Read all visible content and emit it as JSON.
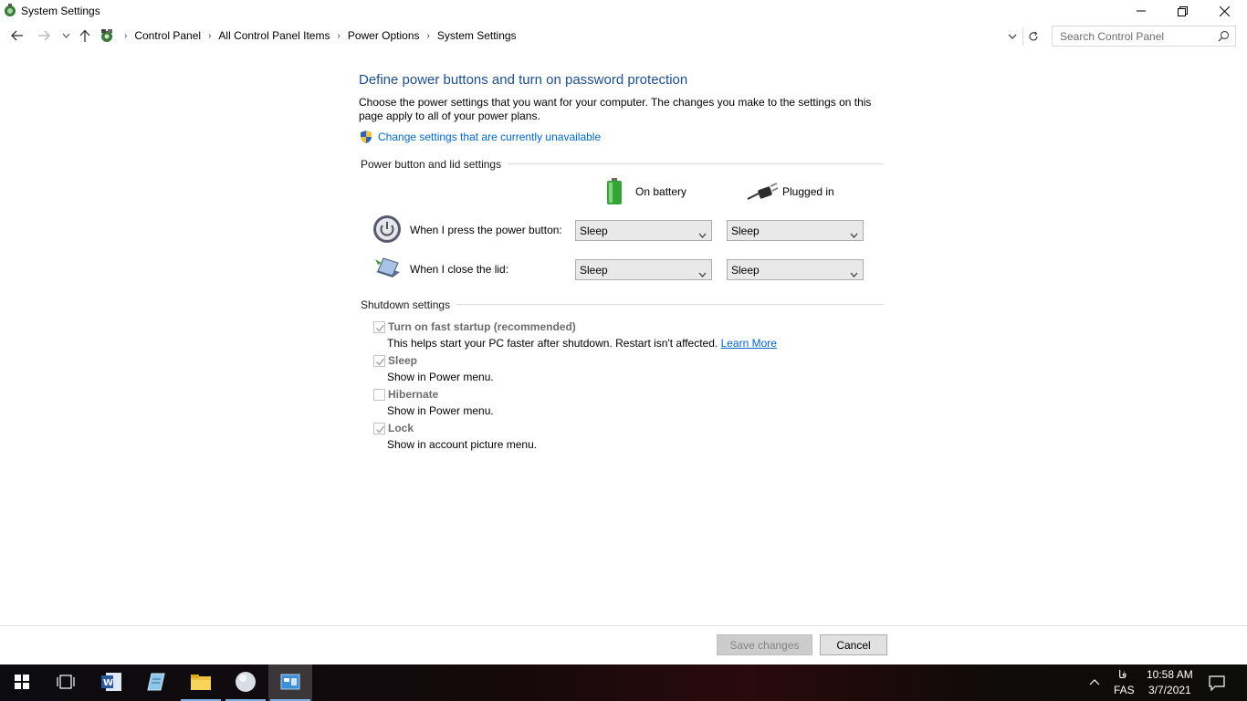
{
  "window": {
    "title": "System Settings"
  },
  "breadcrumbs": [
    "Control Panel",
    "All Control Panel Items",
    "Power Options",
    "System Settings"
  ],
  "search": {
    "placeholder": "Search Control Panel"
  },
  "main": {
    "title": "Define power buttons and turn on password protection",
    "description": "Choose the power settings that you want for your computer. The changes you make to the settings on this page apply to all of your power plans.",
    "change_link": "Change settings that are currently unavailable",
    "power_section": {
      "header": "Power button and lid settings",
      "col_battery": "On battery",
      "col_plugged": "Plugged in",
      "rows": [
        {
          "label": "When I press the power button:",
          "battery": "Sleep",
          "plugged": "Sleep"
        },
        {
          "label": "When I close the lid:",
          "battery": "Sleep",
          "plugged": "Sleep"
        }
      ]
    },
    "shutdown_section": {
      "header": "Shutdown settings",
      "items": [
        {
          "label": "Turn on fast startup (recommended)",
          "desc": "This helps start your PC faster after shutdown. Restart isn't affected.",
          "link": "Learn More",
          "checked": true
        },
        {
          "label": "Sleep",
          "desc": "Show in Power menu.",
          "checked": true
        },
        {
          "label": "Hibernate",
          "desc": "Show in Power menu.",
          "checked": false
        },
        {
          "label": "Lock",
          "desc": "Show in account picture menu.",
          "checked": true
        }
      ]
    }
  },
  "footer": {
    "save_label": "Save changes",
    "cancel_label": "Cancel"
  },
  "taskbar": {
    "apps": [
      "start-icon",
      "task-view-icon",
      "word-icon",
      "notepad-icon",
      "file-explorer-icon",
      "app-circle-icon",
      "control-panel-icon"
    ],
    "time": "10:58 AM",
    "date": "3/7/2021",
    "lang_top": "فا",
    "lang_bottom": "FAS"
  },
  "colors": {
    "title_blue": "#1e4e8c",
    "link_blue": "#0066cc"
  }
}
